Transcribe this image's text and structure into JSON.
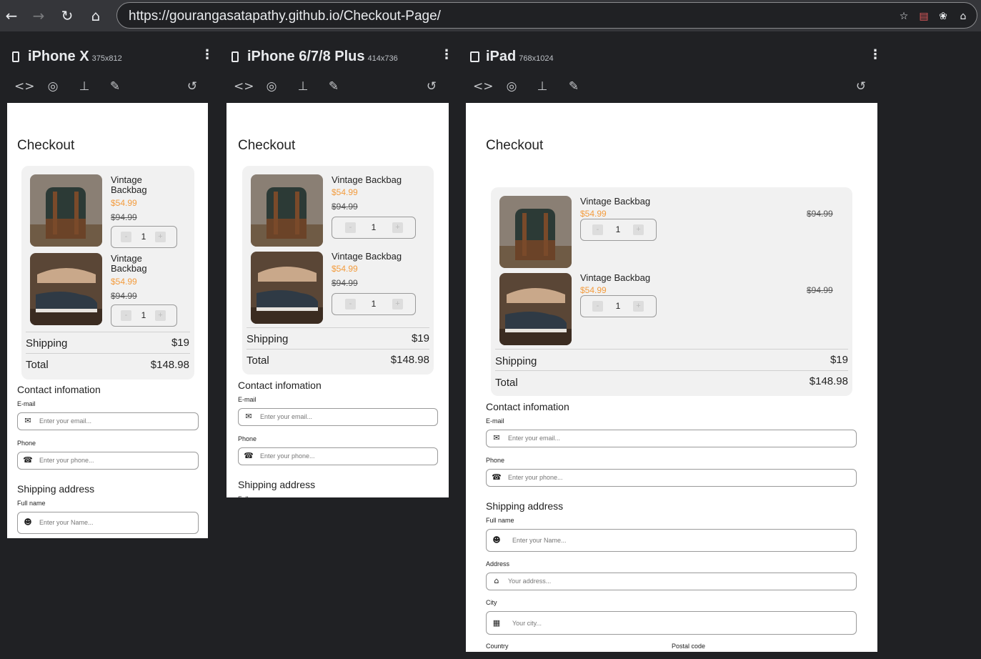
{
  "browser": {
    "url": "https://gourangasatapathy.github.io/Checkout-Page/",
    "back_icon": "arrow-left-icon",
    "forward_icon": "arrow-right-icon",
    "reload_icon": "reload-icon",
    "home_icon": "home-icon"
  },
  "devices": [
    {
      "name": "iPhone X",
      "size": "375x812"
    },
    {
      "name": "iPhone 6/7/8 Plus",
      "size": "414x736"
    },
    {
      "name": "iPad",
      "size": "768x1024"
    }
  ],
  "page": {
    "title": "Checkout",
    "items": [
      {
        "name": "Vintage Backbag",
        "price": "$54.99",
        "old_price": "$94.99",
        "qty": "1",
        "minus": "-",
        "plus": "+"
      },
      {
        "name": "Vintage Backbag",
        "price": "$54.99",
        "old_price": "$94.99",
        "qty": "1",
        "minus": "-",
        "plus": "+"
      }
    ],
    "shipping_label": "Shipping",
    "shipping_value": "$19",
    "total_label": "Total",
    "total_value": "$148.98",
    "contact_heading": "Contact infomation",
    "email_label": "E-mail",
    "email_placeholder": "Enter your email...",
    "phone_label": "Phone",
    "phone_placeholder": "Enter your phone...",
    "shipping_heading": "Shipping address",
    "fullname_label": "Full name",
    "fullname_placeholder": "Enter your Name...",
    "address_label": "Address",
    "address_placeholder": "Your address...",
    "city_label": "City",
    "city_placeholder": "Your city...",
    "country_label": "Country",
    "postal_label": "Postal code"
  },
  "colors": {
    "accent": "#f39c3e",
    "cart_bg": "#f1f1f1",
    "chrome_bg": "#35363a",
    "page_bg": "#202124"
  }
}
